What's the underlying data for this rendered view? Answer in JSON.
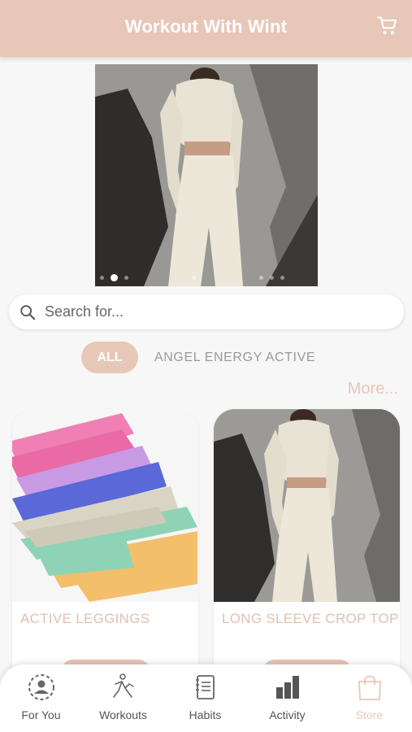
{
  "header": {
    "title": "Workout With Wint",
    "cart_icon": "cart-icon"
  },
  "banner": {
    "slides_count": 8,
    "active_slide": 2
  },
  "search": {
    "placeholder": "Search for...",
    "value": ""
  },
  "filters": {
    "items": [
      {
        "label": "ALL",
        "selected": true
      },
      {
        "label": "ANGEL ENERGY ACTIVE",
        "selected": false
      }
    ]
  },
  "more_label": "More...",
  "products": [
    {
      "title": "ACTIVE LEGGINGS"
    },
    {
      "title": "LONG SLEEVE CROP TOP"
    }
  ],
  "tabbar": {
    "tabs": [
      {
        "label": "For You",
        "icon": "for-you-icon",
        "active": false
      },
      {
        "label": "Workouts",
        "icon": "workouts-icon",
        "active": false
      },
      {
        "label": "Habits",
        "icon": "habits-icon",
        "active": false
      },
      {
        "label": "Activity",
        "icon": "activity-icon",
        "active": false
      },
      {
        "label": "Store",
        "icon": "store-icon",
        "active": true
      }
    ]
  },
  "colors": {
    "accent": "#e7c7b8",
    "background": "#f7f7f7",
    "muted_text": "#9a9a9a"
  }
}
